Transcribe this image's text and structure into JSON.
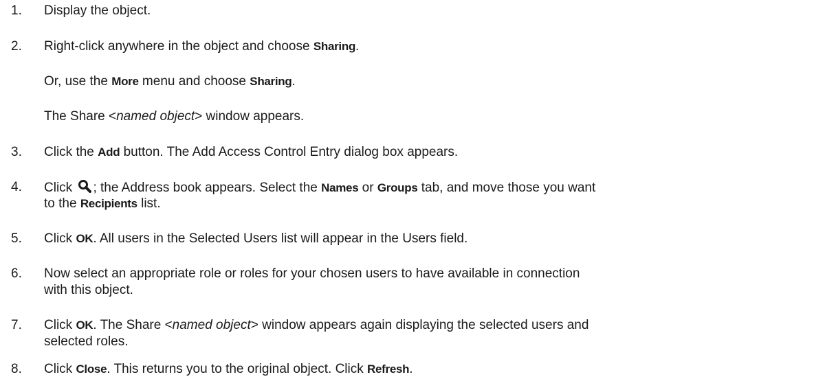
{
  "steps": [
    {
      "num": "1.",
      "text": "Display the object."
    },
    {
      "num": "2.",
      "a": "Right-click anywhere in the object and choose ",
      "b1": "Sharing",
      "c": ".",
      "sub1": {
        "a": "Or, use the ",
        "b1": "More",
        "c": " menu and choose ",
        "b2": "Sharing",
        "d": "."
      },
      "sub2": {
        "a": "The Share <",
        "i1": "named object",
        "b": "> window appears."
      }
    },
    {
      "num": "3.",
      "a": "Click the ",
      "b1": "Add",
      "c": " button. The Add Access Control Entry dialog box appears."
    },
    {
      "num": "4.",
      "a": "Click ",
      "icon": "search-icon",
      "b": "; the Address book appears. Select the ",
      "b1": "Names",
      "c": " or ",
      "b2": "Groups",
      "d": " tab, and move those you want",
      "e": "to the ",
      "b3": "Recipients",
      "f": " list."
    },
    {
      "num": "5.",
      "a": "Click ",
      "b1": "OK",
      "c": ". All users in the Selected Users list will appear in the Users field."
    },
    {
      "num": "6.",
      "a": "Now select an appropriate role or roles for your chosen users to have available in connection",
      "b": "with this object."
    },
    {
      "num": "7.",
      "a": "Click ",
      "b1": "OK",
      "c": ". The Share <",
      "i1": "named object",
      "d": "> window appears again displaying the selected users and",
      "e": "selected roles."
    },
    {
      "num": "8.",
      "a": "Click ",
      "b1": "Close",
      "c": ". This returns you to the original object. Click ",
      "b2": "Refresh",
      "d": "."
    }
  ]
}
